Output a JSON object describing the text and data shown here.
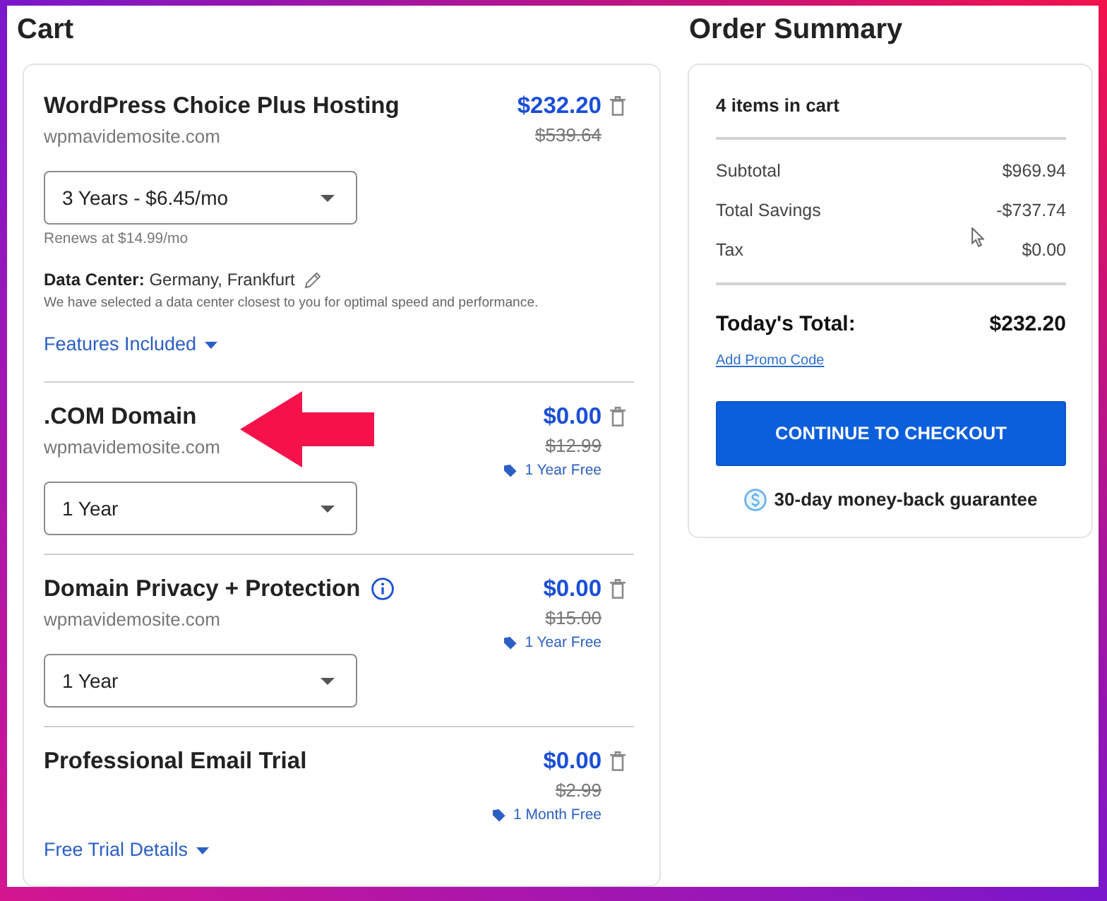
{
  "cart": {
    "title": "Cart",
    "items": [
      {
        "name": "WordPress Choice Plus Hosting",
        "domain": "wpmavidemosite.com",
        "info": false,
        "annotated": false,
        "price": "$232.20",
        "original_price": "$539.64",
        "term": "3 Years - $6.45/mo",
        "renewal": "Renews at $14.99/mo",
        "data_center": "**Data Center:** Germany, Frankfurt",
        "data_center_note": "We have selected a data center closest to you for optimal speed and performance.",
        "details_link": "Features Included"
      },
      {
        "name": ".COM Domain",
        "domain": "wpmavidemosite.com",
        "info": false,
        "annotated": true,
        "price": "$0.00",
        "original_price": "$12.99",
        "promo": "1 Year Free",
        "term": "1 Year"
      },
      {
        "name": "Domain Privacy + Protection",
        "domain": "wpmavidemosite.com",
        "info": true,
        "annotated": false,
        "price": "$0.00",
        "original_price": "$15.00",
        "promo": "1 Year Free",
        "term": "1 Year"
      },
      {
        "name": "Professional Email Trial",
        "info": false,
        "annotated": false,
        "price": "$0.00",
        "original_price": "$2.99",
        "promo": "1 Month Free",
        "details_link": "Free Trial Details"
      }
    ]
  },
  "order_summary": {
    "title": "Order Summary",
    "item_count": "4 items in cart",
    "lines": [
      {
        "label": "Subtotal",
        "value": "$969.94"
      },
      {
        "label": "Total Savings",
        "value": "-$737.74"
      },
      {
        "label": "Tax",
        "value": "$0.00"
      }
    ],
    "total": {
      "label": "Today's Total:",
      "value": "$232.20"
    },
    "promo_link": "Add Promo Code",
    "checkout_button": "CONTINUE TO CHECKOUT",
    "guarantee": "30-day money-back guarantee"
  }
}
